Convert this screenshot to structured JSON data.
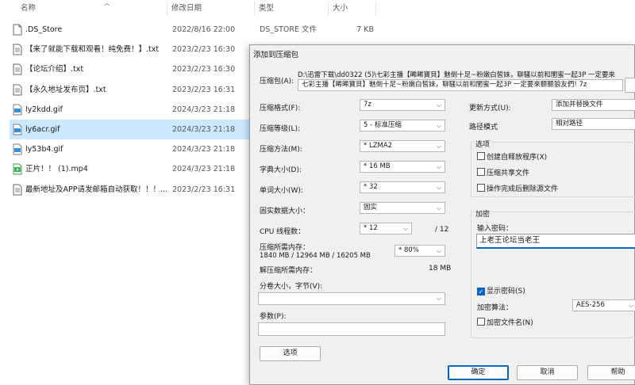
{
  "columns": {
    "name": "名称",
    "date": "修改日期",
    "type": "类型",
    "size": "大小"
  },
  "files": [
    {
      "name": ".DS_Store",
      "date": "2022/8/16 22:00",
      "type": "DS_STORE 文件",
      "size": "7 KB",
      "icon": "blank-file-icon"
    },
    {
      "name": "【来了就能下载和观看！纯免费！】.txt",
      "date": "2023/2/23 16:30",
      "type": "",
      "size": "",
      "icon": "text-file-icon"
    },
    {
      "name": "【论坛介绍】.txt",
      "date": "2023/2/23 16:30",
      "type": "",
      "size": "",
      "icon": "text-file-icon"
    },
    {
      "name": "【永久地址发布页】.txt",
      "date": "2023/2/23 16:31",
      "type": "",
      "size": "",
      "icon": "text-file-icon"
    },
    {
      "name": "ly2kdd.gif",
      "date": "2024/3/23 21:18",
      "type": "",
      "size": "",
      "icon": "gif-file-icon"
    },
    {
      "name": "ly6acr.gif",
      "date": "2024/3/23 21:18",
      "type": "",
      "size": "",
      "icon": "gif-file-icon"
    },
    {
      "name": "ly53b4.gif",
      "date": "2024/3/23 21:18",
      "type": "",
      "size": "",
      "icon": "gif-file-icon"
    },
    {
      "name": "正片！！ (1).mp4",
      "date": "2024/3/23 21:18",
      "type": "",
      "size": "",
      "icon": "video-file-icon"
    },
    {
      "name": "最新地址及APP请发邮箱自动获取！！！...",
      "date": "2023/2/23 16:31",
      "type": "",
      "size": "",
      "icon": "text-file-icon"
    }
  ],
  "dialog": {
    "title": "添加到压缩包",
    "archive_label": "压缩包(A):",
    "archive_dir": "D:\\迅雷下载\\dd0322 (5)\\七彩主播【晞晞寶貝】魅倒十足~粉嫩白皙妹，聊騷以前和閨蜜一起3P 一定要來",
    "archive_name": "七彩主播【晞晞寶貝】魅倒十足~粉嫩白皙妹，聊騷以前和閨蜜一起3P 一定要來聽聽狼友們! 7z",
    "format_label": "压缩格式(F):",
    "format_value": "7z",
    "level_label": "压缩等级(L):",
    "level_value": "5 - 标准压缩",
    "method_label": "压缩方法(M):",
    "method_value": "* LZMA2",
    "dict_label": "字典大小(D):",
    "dict_value": "* 16 MB",
    "word_label": "单词大小(W):",
    "word_value": "* 32",
    "solid_label": "固实数据大小：",
    "solid_value": "固实",
    "cpu_label": "CPU 线程数：",
    "cpu_value": "* 12",
    "cpu_total": "/ 12",
    "mem_label": "压缩所需内存：",
    "mem_detail": "1840 MB / 12964 MB / 16205 MB",
    "mem_value": "* 80%",
    "dmem_label": "解压缩所需内存：",
    "dmem_value": "18 MB",
    "split_label": "分卷大小，字节(V):",
    "params_label": "参数(P):",
    "options_button": "选项",
    "update_label": "更新方式(U):",
    "update_value": "添加并替换文件",
    "path_label": "路径模式",
    "path_value": "相对路径",
    "options_group": "选项",
    "opt_sfx": "创建自释放程序(X)",
    "opt_shared": "压缩共享文件",
    "opt_delete": "操作完成后删除源文件",
    "encrypt_group": "加密",
    "password_label": "输入密码：",
    "password_value": "上老王论坛当老王",
    "show_password": "显示密码(S)",
    "enc_method_label": "加密算法：",
    "enc_method_value": "AES-256",
    "encrypt_names": "加密文件名(N)",
    "ok_button": "确定",
    "cancel_button": "取消",
    "help_button": "帮助"
  }
}
